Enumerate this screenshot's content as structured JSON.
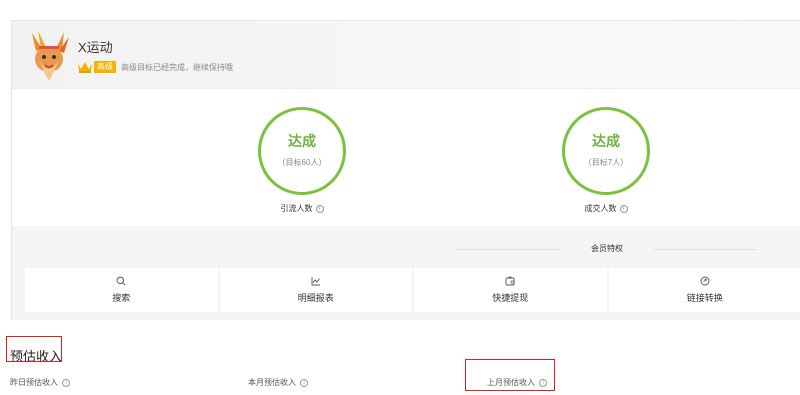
{
  "shop": {
    "name": "X运动",
    "level_badge": "高级",
    "level_desc": "高级目标已经完成，继续保持哦"
  },
  "goals": [
    {
      "status": "达成",
      "target": "（目标60人）",
      "label": "引流人数"
    },
    {
      "status": "达成",
      "target": "（目标7人）",
      "label": "成交人数"
    }
  ],
  "privileges": {
    "title": "会员特权",
    "items": [
      {
        "label": "搜索",
        "icon": "search-icon"
      },
      {
        "label": "明细报表",
        "icon": "chart-icon"
      },
      {
        "label": "快捷提现",
        "icon": "wallet-icon"
      },
      {
        "label": "链接转换",
        "icon": "link-convert-icon"
      }
    ]
  },
  "income": {
    "title": "预估收入",
    "items": [
      {
        "label": "昨日预估收入"
      },
      {
        "label": "本月预估收入"
      },
      {
        "label": "上月预估收入"
      }
    ]
  },
  "colors": {
    "accent_green": "#7cc13e",
    "badge_gold": "#f3b300",
    "highlight_red": "#e02020"
  }
}
